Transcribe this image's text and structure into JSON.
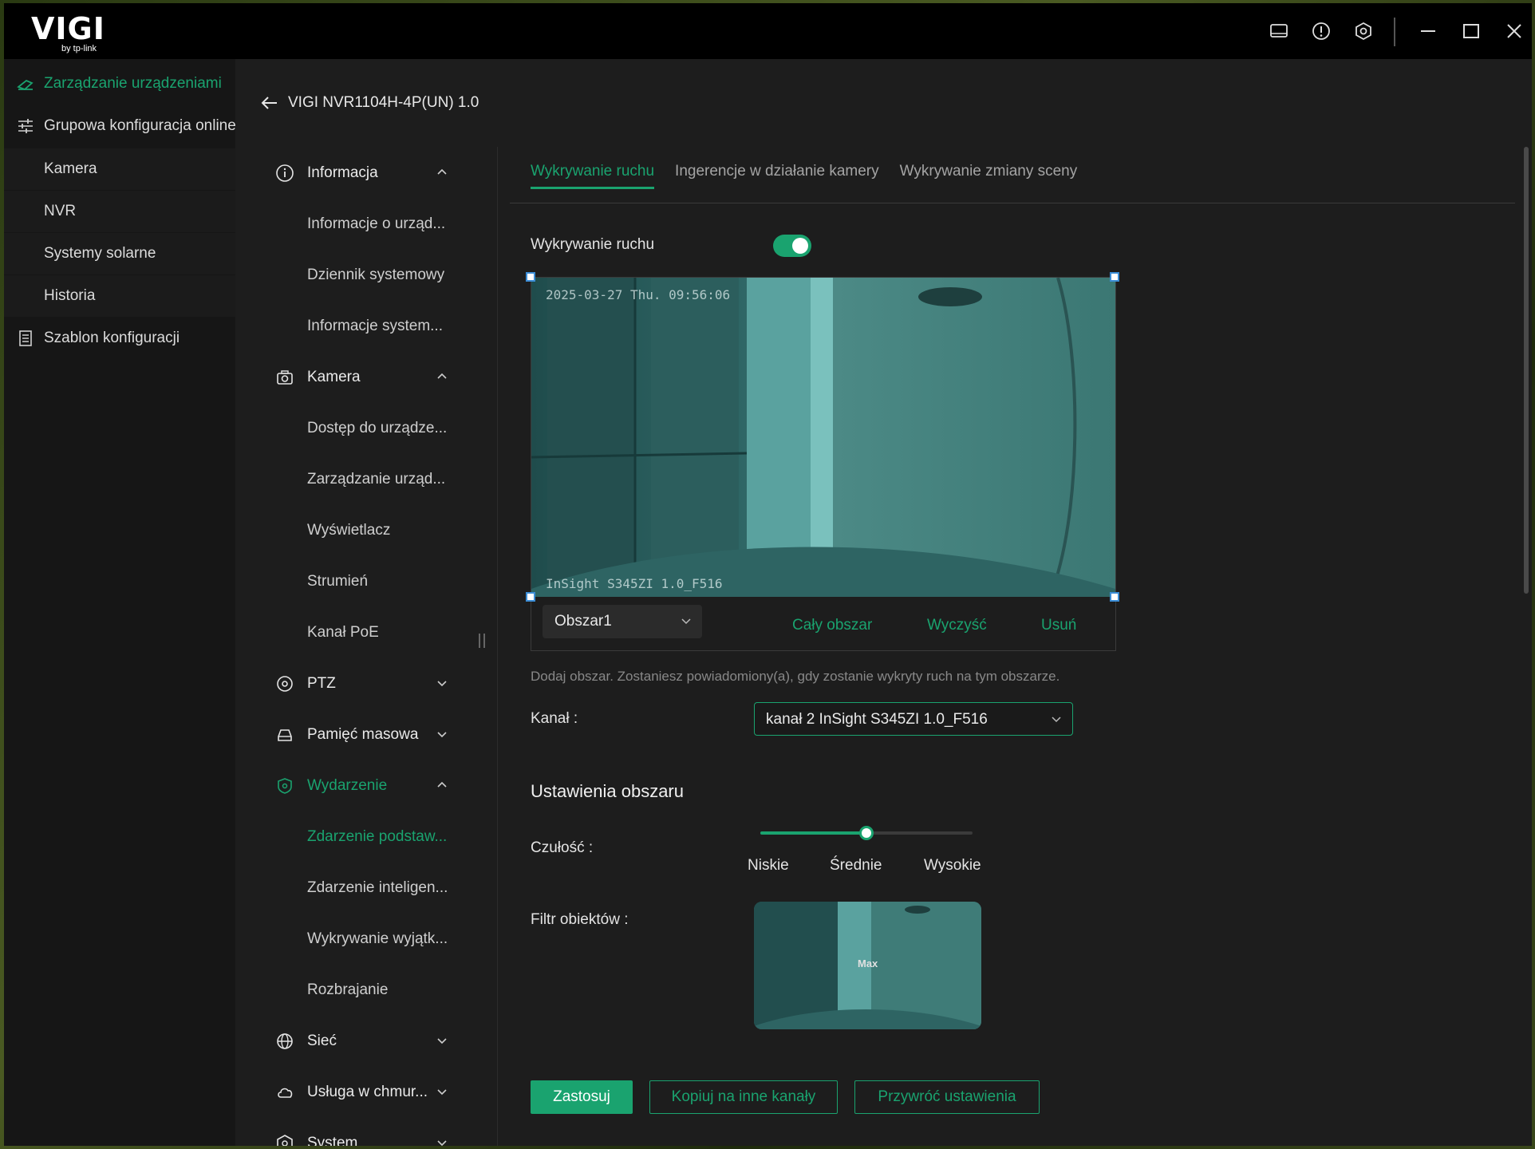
{
  "titlebar": {
    "logo_main": "VIGI",
    "logo_sub": "by tp-link",
    "icons": [
      "screen-icon",
      "info-icon",
      "settings-icon",
      "minimize-icon",
      "maximize-icon",
      "close-icon"
    ]
  },
  "sidebar": {
    "items": [
      {
        "label": "Zarządzanie urządzeniami",
        "icon": "device-management-icon",
        "active": true
      },
      {
        "label": "Grupowa konfiguracja online",
        "icon": "sliders-icon"
      },
      {
        "label": "Kamera"
      },
      {
        "label": "NVR"
      },
      {
        "label": "Systemy solarne"
      },
      {
        "label": "Historia"
      },
      {
        "label": "Szablon konfiguracji",
        "icon": "template-icon"
      }
    ]
  },
  "device": {
    "title": "VIGI NVR1104H-4P(UN) 1.0"
  },
  "nav": {
    "items": [
      {
        "label": "Informacja",
        "icon": "info-circle-icon",
        "type": "head",
        "expanded": true
      },
      {
        "label": "Informacje o urząd..."
      },
      {
        "label": "Dziennik systemowy"
      },
      {
        "label": "Informacje system..."
      },
      {
        "label": "Kamera",
        "icon": "camera-icon",
        "type": "head",
        "expanded": true
      },
      {
        "label": "Dostęp do urządze..."
      },
      {
        "label": "Zarządzanie urząd..."
      },
      {
        "label": "Wyświetlacz"
      },
      {
        "label": "Strumień"
      },
      {
        "label": "Kanał PoE"
      },
      {
        "label": "PTZ",
        "icon": "ptz-icon",
        "type": "head",
        "expanded": false
      },
      {
        "label": "Pamięć masowa",
        "icon": "storage-icon",
        "type": "head",
        "expanded": false
      },
      {
        "label": "Wydarzenie",
        "icon": "event-icon",
        "type": "head",
        "expanded": true,
        "active": true
      },
      {
        "label": "Zdarzenie podstaw...",
        "active": true
      },
      {
        "label": "Zdarzenie inteligen..."
      },
      {
        "label": "Wykrywanie wyjątk..."
      },
      {
        "label": "Rozbrajanie"
      },
      {
        "label": "Sieć",
        "icon": "globe-icon",
        "type": "head",
        "expanded": false
      },
      {
        "label": "Usługa w chmur...",
        "icon": "cloud-icon",
        "type": "head",
        "expanded": false
      },
      {
        "label": "System",
        "icon": "system-icon",
        "type": "head",
        "expanded": false
      }
    ]
  },
  "tabs": [
    {
      "label": "Wykrywanie ruchu",
      "active": true
    },
    {
      "label": "Ingerencje w działanie kamery"
    },
    {
      "label": "Wykrywanie zmiany sceny"
    }
  ],
  "motion": {
    "label": "Wykrywanie ruchu",
    "enabled": true,
    "osd_time": "2025-03-27 Thu. 09:56:06",
    "osd_name": "InSight S345ZI 1.0_F516",
    "area_select": "Obszar1",
    "full_area": "Cały obszar",
    "clear": "Wyczyść",
    "delete": "Usuń",
    "hint": "Dodaj obszar. Zostaniesz powiadomiony(a), gdy zostanie wykryty ruch na tym obszarze.",
    "channel_label": "Kanał :",
    "channel_value": "kanał 2 InSight S345ZI 1.0_F516"
  },
  "area_settings": {
    "title": "Ustawienia obszaru",
    "sensitivity_label": "Czułość :",
    "sensitivity_value": 0.5,
    "levels": [
      "Niskie",
      "Średnie",
      "Wysokie"
    ],
    "filter_label": "Filtr obiektów :",
    "filter_max": "Max"
  },
  "buttons": {
    "apply": "Zastosuj",
    "copy": "Kopiuj na inne kanały",
    "restore": "Przywróć ustawienia"
  },
  "colors": {
    "accent": "#1aa36f",
    "background": "#1d1d1d"
  }
}
